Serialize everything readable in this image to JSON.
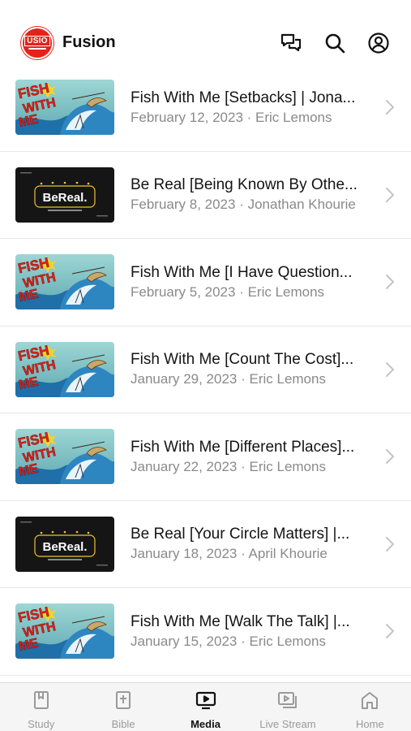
{
  "header": {
    "app_title": "Fusion",
    "logo_text": "USIO",
    "logo_color": "#e3231b",
    "icons": [
      "chat-icon",
      "search-icon",
      "profile-icon"
    ]
  },
  "media_list": [
    {
      "title": "Fish With Me [Setbacks] | Jona...",
      "date": "February 12, 2023",
      "speaker": "Eric Lemons",
      "thumb": "fish-with-me",
      "meta": "February 12, 2023 · Eric Lemons"
    },
    {
      "title": "Be Real [Being Known By Othe...",
      "date": "February 8, 2023",
      "speaker": "Jonathan Khourie",
      "thumb": "bereal",
      "meta": "February 8, 2023 · Jonathan Khourie"
    },
    {
      "title": "Fish With Me [I Have Question...",
      "date": "February 5, 2023",
      "speaker": "Eric Lemons",
      "thumb": "fish-with-me",
      "meta": "February 5, 2023 · Eric Lemons"
    },
    {
      "title": "Fish With Me [Count The Cost]...",
      "date": "January 29, 2023",
      "speaker": "Eric Lemons",
      "thumb": "fish-with-me",
      "meta": "January 29, 2023 · Eric Lemons"
    },
    {
      "title": "Fish With Me [Different Places]...",
      "date": "January 22, 2023",
      "speaker": "Eric Lemons",
      "thumb": "fish-with-me",
      "meta": "January 22, 2023 · Eric Lemons"
    },
    {
      "title": "Be Real [Your Circle Matters] |...",
      "date": "January 18, 2023",
      "speaker": "April Khourie",
      "thumb": "bereal",
      "meta": "January 18, 2023 · April Khourie"
    },
    {
      "title": "Fish With Me [Walk The Talk] |...",
      "date": "January 15, 2023",
      "speaker": "Eric Lemons",
      "thumb": "fish-with-me",
      "meta": "January 15, 2023 · Eric Lemons"
    }
  ],
  "thumb_text": {
    "fish_line1": "FISH",
    "fish_line2": "WITH",
    "fish_line3": "ME",
    "bereal_logo": "BeReal."
  },
  "tabbar": {
    "tabs": [
      {
        "label": "Study",
        "icon": "book-icon",
        "active": false
      },
      {
        "label": "Bible",
        "icon": "bible-icon",
        "active": false
      },
      {
        "label": "Media",
        "icon": "tv-icon",
        "active": true
      },
      {
        "label": "Live Stream",
        "icon": "live-stream-icon",
        "active": false
      },
      {
        "label": "Home",
        "icon": "home-icon",
        "active": false
      }
    ]
  },
  "colors": {
    "accent": "#e3231b",
    "muted_text": "#8a8a8a",
    "divider": "#e7e7e7",
    "tab_active": "#111111",
    "tab_inactive": "#9a9a9a"
  }
}
